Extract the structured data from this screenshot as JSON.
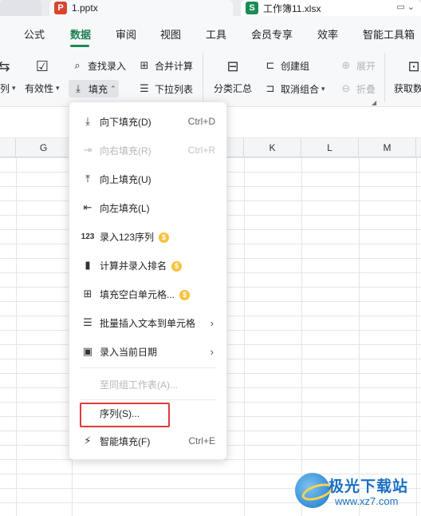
{
  "tabs": [
    {
      "label": ""
    },
    {
      "label": "1.pptx",
      "badge": "P",
      "badge_color": "#d9452f"
    },
    {
      "label": "工作簿11.xlsx",
      "badge": "S",
      "badge_color": "#1a8c55"
    }
  ],
  "menu": {
    "items": [
      "公式",
      "数据",
      "审阅",
      "视图",
      "工具",
      "会员专享",
      "效率",
      "智能工具箱"
    ],
    "active": "数据"
  },
  "toolbar": {
    "left_partial_label": "列",
    "validity": "有效性",
    "find_entry": "查找录入",
    "fill": "填充",
    "merge_calc": "合并计算",
    "dropdown_list": "下拉列表",
    "subtotal": "分类汇总",
    "create_group": "创建组",
    "ungroup": "取消组合",
    "expand": "展开",
    "collapse": "折叠",
    "get_data": "获取数"
  },
  "columns": [
    "G",
    "K",
    "L",
    "M"
  ],
  "fill_menu": {
    "items": [
      {
        "label": "向下填充(D)",
        "shortcut": "Ctrl+D",
        "icon": "fill-down-icon",
        "enabled": true
      },
      {
        "label": "向右填充(R)",
        "shortcut": "Ctrl+R",
        "icon": "fill-right-icon",
        "enabled": false
      },
      {
        "label": "向上填充(U)",
        "shortcut": "",
        "icon": "fill-up-icon",
        "enabled": true
      },
      {
        "label": "向左填充(L)",
        "shortcut": "",
        "icon": "fill-left-icon",
        "enabled": true
      },
      {
        "label": "录入123序列",
        "shortcut": "",
        "icon": "sequence-123-icon",
        "enabled": true,
        "premium": true
      },
      {
        "label": "计算并录入排名",
        "shortcut": "",
        "icon": "ranking-icon",
        "enabled": true,
        "premium": true
      },
      {
        "label": "填充空白单元格...",
        "shortcut": "",
        "icon": "fill-blank-cells-icon",
        "enabled": true,
        "premium": true
      },
      {
        "label": "批量插入文本到单元格",
        "shortcut": "",
        "icon": "batch-insert-text-icon",
        "enabled": true,
        "submenu": true
      },
      {
        "label": "录入当前日期",
        "shortcut": "",
        "icon": "calendar-icon",
        "enabled": true,
        "submenu": true
      },
      {
        "label": "至同组工作表(A)...",
        "shortcut": "",
        "icon": "",
        "enabled": false
      },
      {
        "label": "序列(S)...",
        "shortcut": "",
        "icon": "",
        "enabled": true,
        "highlighted": true
      },
      {
        "label": "智能填充(F)",
        "shortcut": "Ctrl+E",
        "icon": "smart-fill-icon",
        "enabled": true
      }
    ],
    "premium_badge": "$"
  },
  "watermark": {
    "title": "极光下载站",
    "url": "www.xz7.com"
  },
  "colors": {
    "accent": "#1a8c55",
    "highlight": "#e23a3a",
    "premium": "#f6c23e"
  }
}
